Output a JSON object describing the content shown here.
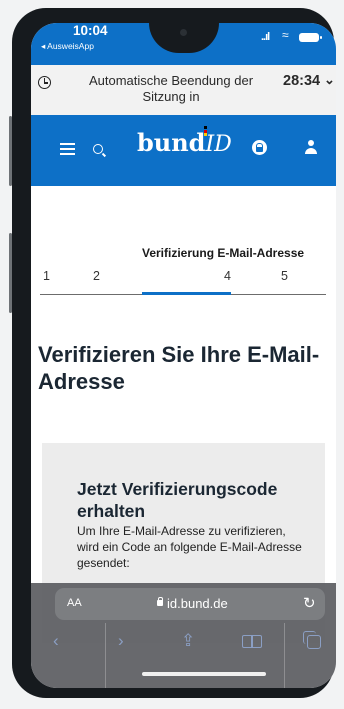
{
  "status_bar": {
    "time": "10:04",
    "back_app": "◂ AusweisApp",
    "signal": "..ıl",
    "wifi": "≈"
  },
  "session": {
    "label": "Automatische Beendung der Sitzung in",
    "timer": "28:34",
    "chevron": "⌄"
  },
  "header": {
    "logo_main": "bund",
    "logo_id": "ID",
    "colors": {
      "brand_blue": "#0d70c7",
      "logo_dot_black": "#000000",
      "logo_dot_red": "#dd0000",
      "logo_dot_gold": "#ffcc00"
    }
  },
  "stepper": {
    "steps": [
      "1",
      "2",
      "4",
      "5"
    ],
    "active_step_label": "Verifizierung E-Mail-Adresse"
  },
  "page": {
    "title": "Verifizieren Sie Ihre E-Mail-Adresse"
  },
  "card": {
    "title": "Jetzt Verifizierungscode erhalten",
    "text": "Um Ihre E-Mail-Adresse zu verifizieren, wird ein Code an folgende E-Mail-Adresse gesendet:"
  },
  "safari": {
    "aa_label": "AA",
    "url": "id.bund.de",
    "reload": "↻",
    "back": "‹",
    "forward": "›",
    "share": "⇪"
  }
}
